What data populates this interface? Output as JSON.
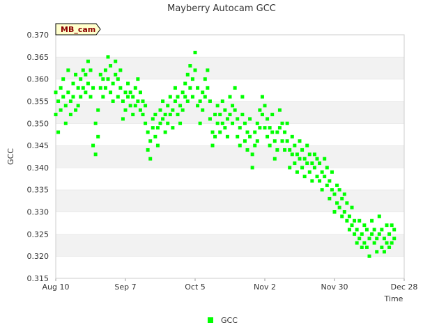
{
  "chart_data": {
    "type": "scatter",
    "title": "Mayberry Autocam GCC",
    "xlabel": "Time",
    "ylabel": "GCC",
    "site_tag": "MB_cam",
    "x_ticks": [
      "Aug 10",
      "Sep 7",
      "Oct 5",
      "Nov 2",
      "Nov 30",
      "Dec 28"
    ],
    "x_range": [
      "Aug 10",
      "Dec 28"
    ],
    "ylim": [
      0.315,
      0.37
    ],
    "y_ticks": [
      "0.315",
      "0.320",
      "0.325",
      "0.330",
      "0.335",
      "0.340",
      "0.345",
      "0.350",
      "0.355",
      "0.360",
      "0.365",
      "0.370"
    ],
    "grid": "horizontal alternating bands",
    "legend_position": "bottom-center",
    "series": [
      {
        "name": "GCC",
        "color": "#00ff00",
        "marker": "square",
        "x_unit": "days since Aug 10",
        "points": [
          [
            0,
            0.357
          ],
          [
            0,
            0.352
          ],
          [
            1,
            0.355
          ],
          [
            1,
            0.348
          ],
          [
            2,
            0.358
          ],
          [
            2,
            0.353
          ],
          [
            3,
            0.356
          ],
          [
            3,
            0.36
          ],
          [
            4,
            0.354
          ],
          [
            4,
            0.35
          ],
          [
            5,
            0.357
          ],
          [
            5,
            0.362
          ],
          [
            6,
            0.355
          ],
          [
            6,
            0.352
          ],
          [
            7,
            0.359
          ],
          [
            7,
            0.356
          ],
          [
            8,
            0.353
          ],
          [
            8,
            0.361
          ],
          [
            9,
            0.358
          ],
          [
            9,
            0.354
          ],
          [
            10,
            0.36
          ],
          [
            10,
            0.356
          ],
          [
            11,
            0.362
          ],
          [
            11,
            0.358
          ],
          [
            12,
            0.361
          ],
          [
            12,
            0.357
          ],
          [
            13,
            0.364
          ],
          [
            13,
            0.359
          ],
          [
            14,
            0.356
          ],
          [
            14,
            0.362
          ],
          [
            15,
            0.358
          ],
          [
            15,
            0.345
          ],
          [
            16,
            0.35
          ],
          [
            16,
            0.343
          ],
          [
            17,
            0.347
          ],
          [
            17,
            0.353
          ],
          [
            18,
            0.358
          ],
          [
            18,
            0.361
          ],
          [
            19,
            0.36
          ],
          [
            19,
            0.356
          ],
          [
            20,
            0.362
          ],
          [
            20,
            0.358
          ],
          [
            21,
            0.365
          ],
          [
            21,
            0.36
          ],
          [
            22,
            0.357
          ],
          [
            22,
            0.363
          ],
          [
            23,
            0.359
          ],
          [
            23,
            0.355
          ],
          [
            24,
            0.361
          ],
          [
            24,
            0.364
          ],
          [
            25,
            0.36
          ],
          [
            25,
            0.356
          ],
          [
            26,
            0.358
          ],
          [
            26,
            0.362
          ],
          [
            27,
            0.355
          ],
          [
            27,
            0.351
          ],
          [
            28,
            0.357
          ],
          [
            28,
            0.353
          ],
          [
            29,
            0.356
          ],
          [
            29,
            0.359
          ],
          [
            30,
            0.354
          ],
          [
            30,
            0.357
          ],
          [
            31,
            0.352
          ],
          [
            31,
            0.356
          ],
          [
            32,
            0.358
          ],
          [
            32,
            0.354
          ],
          [
            33,
            0.36
          ],
          [
            33,
            0.355
          ],
          [
            34,
            0.353
          ],
          [
            34,
            0.357
          ],
          [
            35,
            0.352
          ],
          [
            35,
            0.355
          ],
          [
            36,
            0.35
          ],
          [
            36,
            0.354
          ],
          [
            37,
            0.348
          ],
          [
            37,
            0.344
          ],
          [
            38,
            0.346
          ],
          [
            38,
            0.342
          ],
          [
            39,
            0.349
          ],
          [
            39,
            0.351
          ],
          [
            40,
            0.347
          ],
          [
            40,
            0.352
          ],
          [
            41,
            0.349
          ],
          [
            41,
            0.345
          ],
          [
            42,
            0.353
          ],
          [
            42,
            0.35
          ],
          [
            43,
            0.355
          ],
          [
            43,
            0.351
          ],
          [
            44,
            0.348
          ],
          [
            44,
            0.352
          ],
          [
            45,
            0.354
          ],
          [
            45,
            0.35
          ],
          [
            46,
            0.356
          ],
          [
            46,
            0.352
          ],
          [
            47,
            0.349
          ],
          [
            47,
            0.353
          ],
          [
            48,
            0.355
          ],
          [
            48,
            0.358
          ],
          [
            49,
            0.352
          ],
          [
            49,
            0.356
          ],
          [
            50,
            0.354
          ],
          [
            50,
            0.35
          ],
          [
            51,
            0.357
          ],
          [
            51,
            0.353
          ],
          [
            52,
            0.356
          ],
          [
            52,
            0.359
          ],
          [
            53,
            0.355
          ],
          [
            53,
            0.361
          ],
          [
            54,
            0.358
          ],
          [
            54,
            0.363
          ],
          [
            55,
            0.36
          ],
          [
            55,
            0.356
          ],
          [
            56,
            0.366
          ],
          [
            56,
            0.362
          ],
          [
            57,
            0.358
          ],
          [
            57,
            0.354
          ],
          [
            58,
            0.355
          ],
          [
            58,
            0.35
          ],
          [
            59,
            0.357
          ],
          [
            59,
            0.353
          ],
          [
            60,
            0.36
          ],
          [
            60,
            0.356
          ],
          [
            61,
            0.362
          ],
          [
            61,
            0.358
          ],
          [
            62,
            0.355
          ],
          [
            62,
            0.351
          ],
          [
            63,
            0.348
          ],
          [
            63,
            0.345
          ],
          [
            64,
            0.347
          ],
          [
            64,
            0.352
          ],
          [
            65,
            0.35
          ],
          [
            65,
            0.354
          ],
          [
            66,
            0.352
          ],
          [
            66,
            0.348
          ],
          [
            67,
            0.355
          ],
          [
            67,
            0.35
          ],
          [
            68,
            0.353
          ],
          [
            68,
            0.349
          ],
          [
            69,
            0.351
          ],
          [
            69,
            0.347
          ],
          [
            70,
            0.356
          ],
          [
            70,
            0.352
          ],
          [
            71,
            0.354
          ],
          [
            71,
            0.35
          ],
          [
            72,
            0.358
          ],
          [
            72,
            0.353
          ],
          [
            73,
            0.351
          ],
          [
            73,
            0.347
          ],
          [
            74,
            0.349
          ],
          [
            74,
            0.345
          ],
          [
            75,
            0.352
          ],
          [
            75,
            0.356
          ],
          [
            76,
            0.35
          ],
          [
            76,
            0.346
          ],
          [
            77,
            0.344
          ],
          [
            77,
            0.348
          ],
          [
            78,
            0.347
          ],
          [
            78,
            0.351
          ],
          [
            79,
            0.343
          ],
          [
            79,
            0.34
          ],
          [
            80,
            0.348
          ],
          [
            80,
            0.345
          ],
          [
            81,
            0.346
          ],
          [
            81,
            0.35
          ],
          [
            82,
            0.349
          ],
          [
            82,
            0.353
          ],
          [
            83,
            0.352
          ],
          [
            83,
            0.356
          ],
          [
            84,
            0.354
          ],
          [
            84,
            0.349
          ],
          [
            85,
            0.351
          ],
          [
            85,
            0.347
          ],
          [
            86,
            0.349
          ],
          [
            86,
            0.345
          ],
          [
            87,
            0.352
          ],
          [
            87,
            0.348
          ],
          [
            88,
            0.346
          ],
          [
            88,
            0.342
          ],
          [
            89,
            0.348
          ],
          [
            89,
            0.344
          ],
          [
            90,
            0.349
          ],
          [
            90,
            0.353
          ],
          [
            91,
            0.346
          ],
          [
            91,
            0.35
          ],
          [
            92,
            0.348
          ],
          [
            92,
            0.344
          ],
          [
            93,
            0.35
          ],
          [
            93,
            0.346
          ],
          [
            94,
            0.344
          ],
          [
            94,
            0.34
          ],
          [
            95,
            0.347
          ],
          [
            95,
            0.343
          ],
          [
            96,
            0.345
          ],
          [
            96,
            0.341
          ],
          [
            97,
            0.343
          ],
          [
            97,
            0.339
          ],
          [
            98,
            0.346
          ],
          [
            98,
            0.342
          ],
          [
            99,
            0.344
          ],
          [
            99,
            0.34
          ],
          [
            100,
            0.342
          ],
          [
            100,
            0.338
          ],
          [
            101,
            0.345
          ],
          [
            101,
            0.341
          ],
          [
            102,
            0.343
          ],
          [
            102,
            0.339
          ],
          [
            103,
            0.341
          ],
          [
            103,
            0.337
          ],
          [
            104,
            0.34
          ],
          [
            104,
            0.343
          ],
          [
            105,
            0.338
          ],
          [
            105,
            0.342
          ],
          [
            106,
            0.341
          ],
          [
            106,
            0.337
          ],
          [
            107,
            0.339
          ],
          [
            107,
            0.335
          ],
          [
            108,
            0.338
          ],
          [
            108,
            0.342
          ],
          [
            109,
            0.336
          ],
          [
            109,
            0.34
          ],
          [
            110,
            0.337
          ],
          [
            110,
            0.333
          ],
          [
            111,
            0.335
          ],
          [
            111,
            0.339
          ],
          [
            112,
            0.334
          ],
          [
            112,
            0.33
          ],
          [
            113,
            0.336
          ],
          [
            113,
            0.332
          ],
          [
            114,
            0.331
          ],
          [
            114,
            0.335
          ],
          [
            115,
            0.333
          ],
          [
            115,
            0.329
          ],
          [
            116,
            0.33
          ],
          [
            116,
            0.334
          ],
          [
            117,
            0.328
          ],
          [
            117,
            0.332
          ],
          [
            118,
            0.329
          ],
          [
            118,
            0.326
          ],
          [
            119,
            0.327
          ],
          [
            119,
            0.331
          ],
          [
            120,
            0.325
          ],
          [
            120,
            0.328
          ],
          [
            121,
            0.326
          ],
          [
            121,
            0.323
          ],
          [
            122,
            0.324
          ],
          [
            122,
            0.328
          ],
          [
            123,
            0.325
          ],
          [
            123,
            0.322
          ],
          [
            124,
            0.323
          ],
          [
            124,
            0.327
          ],
          [
            125,
            0.326
          ],
          [
            125,
            0.322
          ],
          [
            126,
            0.324
          ],
          [
            126,
            0.32
          ],
          [
            127,
            0.325
          ],
          [
            127,
            0.328
          ],
          [
            128,
            0.323
          ],
          [
            128,
            0.326
          ],
          [
            129,
            0.324
          ],
          [
            129,
            0.321
          ],
          [
            130,
            0.325
          ],
          [
            130,
            0.329
          ],
          [
            131,
            0.322
          ],
          [
            131,
            0.326
          ],
          [
            132,
            0.324
          ],
          [
            132,
            0.321
          ],
          [
            133,
            0.323
          ],
          [
            133,
            0.327
          ],
          [
            134,
            0.322
          ],
          [
            134,
            0.325
          ],
          [
            135,
            0.327
          ],
          [
            135,
            0.323
          ],
          [
            136,
            0.324
          ],
          [
            136,
            0.326
          ]
        ]
      }
    ]
  }
}
